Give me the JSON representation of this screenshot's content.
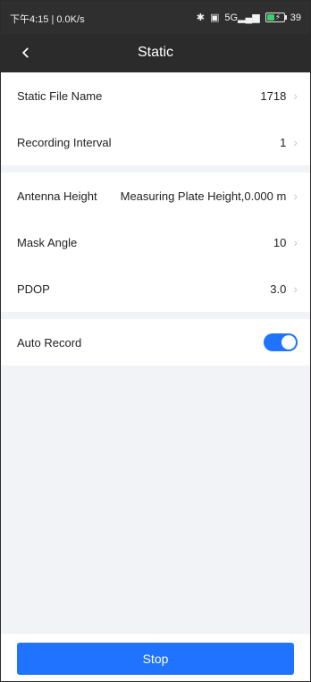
{
  "status_bar": {
    "left_text": "下午4:15 | 0.0K/s",
    "right_battery_text": "39",
    "signal_text": "5G"
  },
  "app_bar": {
    "title": "Static"
  },
  "settings": {
    "group1": [
      {
        "label": "Static File Name",
        "value": "1718"
      },
      {
        "label": "Recording Interval",
        "value": "1"
      }
    ],
    "group2": [
      {
        "label": "Antenna Height",
        "value": "Measuring Plate Height,0.000 m"
      },
      {
        "label": "Mask Angle",
        "value": "10"
      },
      {
        "label": "PDOP",
        "value": "3.0"
      }
    ],
    "auto_record": {
      "label": "Auto Record",
      "enabled": true
    }
  },
  "footer": {
    "stop_label": "Stop"
  },
  "colors": {
    "topbar": "#2b2b2b",
    "accent": "#1f73ff",
    "divider_bg": "#f2f3f6"
  },
  "icons": {
    "back": "chevron-left-icon",
    "row_arrow": "chevron-right-icon"
  }
}
